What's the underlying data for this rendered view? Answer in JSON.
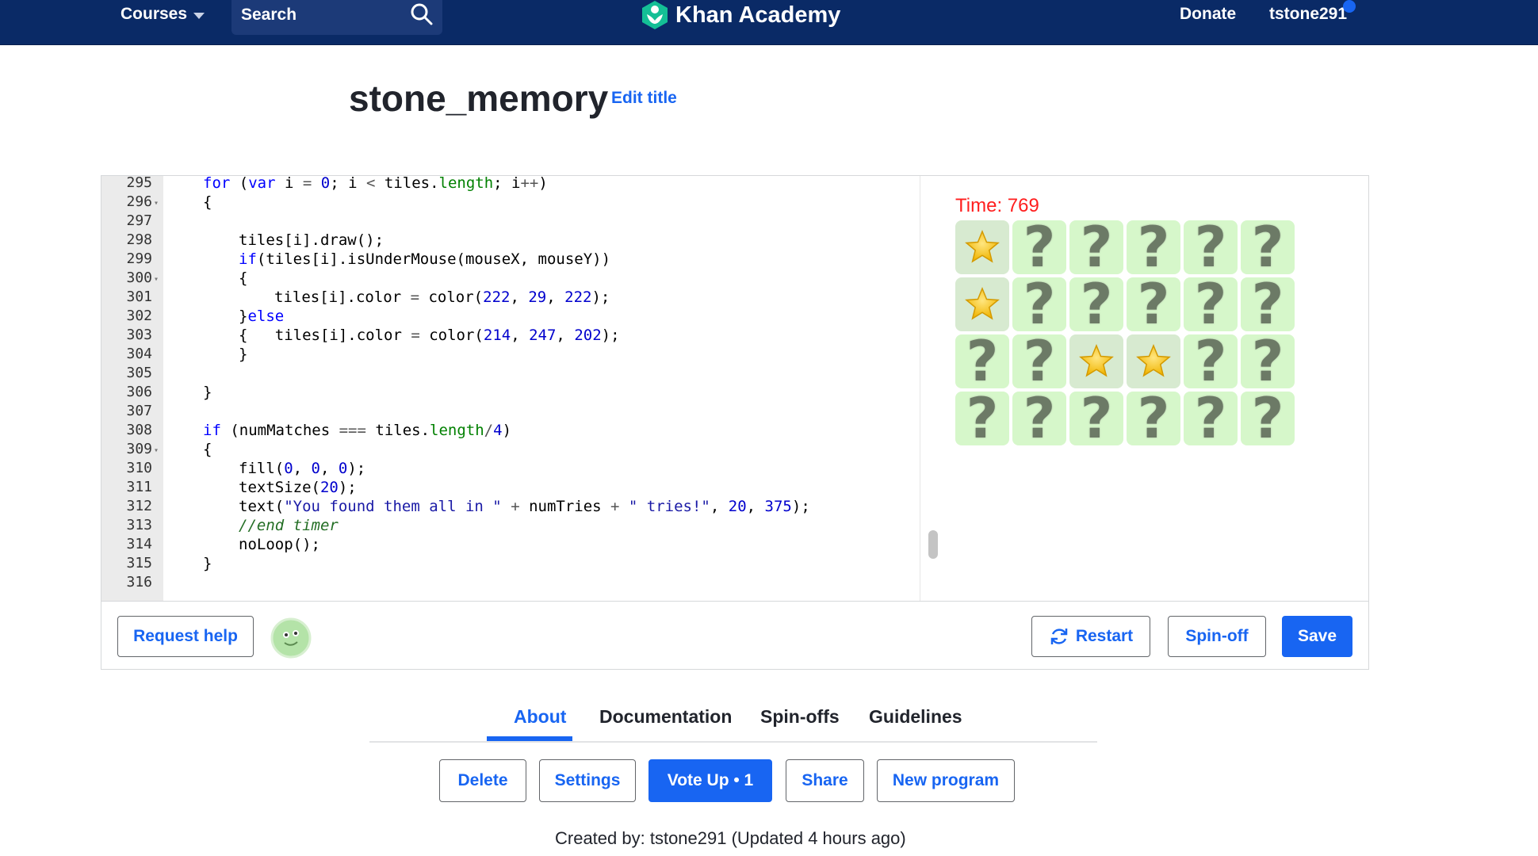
{
  "nav": {
    "courses_label": "Courses",
    "search_placeholder": "Search",
    "brand": "Khan Academy",
    "donate_label": "Donate",
    "username": "tstone291"
  },
  "program": {
    "title": "stone_memory",
    "edit_title_label": "Edit title"
  },
  "editor": {
    "lines": [
      {
        "n": "295",
        "fold": false,
        "tokens": [
          [
            "kw",
            "for "
          ],
          [
            "",
            "("
          ],
          [
            "kw",
            "var "
          ],
          [
            "",
            "i "
          ],
          [
            "op",
            "= "
          ],
          [
            "num",
            "0"
          ],
          [
            "",
            "; i "
          ],
          [
            "op",
            "< "
          ],
          [
            "",
            "tiles."
          ],
          [
            "prop",
            "length"
          ],
          [
            "",
            "; i"
          ],
          [
            "op",
            "++"
          ],
          [
            "",
            ")"
          ]
        ],
        "indent": 1
      },
      {
        "n": "296",
        "fold": true,
        "tokens": [
          [
            "",
            "{"
          ]
        ],
        "indent": 1
      },
      {
        "n": "297",
        "fold": false,
        "tokens": [],
        "indent": 1
      },
      {
        "n": "298",
        "fold": false,
        "tokens": [
          [
            "",
            "tiles[i].draw();"
          ]
        ],
        "indent": 2
      },
      {
        "n": "299",
        "fold": false,
        "tokens": [
          [
            "kw",
            "if"
          ],
          [
            "",
            "(tiles[i].isUnderMouse(mouseX, mouseY))"
          ]
        ],
        "indent": 2
      },
      {
        "n": "300",
        "fold": true,
        "tokens": [
          [
            "",
            "{"
          ]
        ],
        "indent": 2
      },
      {
        "n": "301",
        "fold": false,
        "tokens": [
          [
            "",
            "tiles[i].color "
          ],
          [
            "op",
            "= "
          ],
          [
            "",
            "color("
          ],
          [
            "num",
            "222"
          ],
          [
            "",
            ", "
          ],
          [
            "num",
            "29"
          ],
          [
            "",
            ", "
          ],
          [
            "num",
            "222"
          ],
          [
            "",
            ");"
          ]
        ],
        "indent": 3
      },
      {
        "n": "302",
        "fold": false,
        "tokens": [
          [
            "",
            "}"
          ],
          [
            "kw",
            "else"
          ]
        ],
        "indent": 2
      },
      {
        "n": "303",
        "fold": false,
        "tokens": [
          [
            "",
            "{   tiles[i].color "
          ],
          [
            "op",
            "= "
          ],
          [
            "",
            "color("
          ],
          [
            "num",
            "214"
          ],
          [
            "",
            ", "
          ],
          [
            "num",
            "247"
          ],
          [
            "",
            ", "
          ],
          [
            "num",
            "202"
          ],
          [
            "",
            ");"
          ]
        ],
        "indent": 2
      },
      {
        "n": "304",
        "fold": false,
        "tokens": [
          [
            "",
            "}"
          ]
        ],
        "indent": 2
      },
      {
        "n": "305",
        "fold": false,
        "tokens": [],
        "indent": 1
      },
      {
        "n": "306",
        "fold": false,
        "tokens": [
          [
            "",
            "}"
          ]
        ],
        "indent": 1
      },
      {
        "n": "307",
        "fold": false,
        "tokens": [],
        "indent": 1
      },
      {
        "n": "308",
        "fold": false,
        "tokens": [
          [
            "kw",
            "if "
          ],
          [
            "",
            "(numMatches "
          ],
          [
            "op",
            "=== "
          ],
          [
            "",
            "tiles."
          ],
          [
            "prop",
            "length"
          ],
          [
            "op",
            "/"
          ],
          [
            "num",
            "4"
          ],
          [
            "",
            ")"
          ]
        ],
        "indent": 1
      },
      {
        "n": "309",
        "fold": true,
        "tokens": [
          [
            "",
            "{"
          ]
        ],
        "indent": 1
      },
      {
        "n": "310",
        "fold": false,
        "tokens": [
          [
            "",
            "fill("
          ],
          [
            "num",
            "0"
          ],
          [
            "",
            ", "
          ],
          [
            "num",
            "0"
          ],
          [
            "",
            ", "
          ],
          [
            "num",
            "0"
          ],
          [
            "",
            ");"
          ]
        ],
        "indent": 2
      },
      {
        "n": "311",
        "fold": false,
        "tokens": [
          [
            "",
            "textSize("
          ],
          [
            "num",
            "20"
          ],
          [
            "",
            ");"
          ]
        ],
        "indent": 2
      },
      {
        "n": "312",
        "fold": false,
        "tokens": [
          [
            "",
            "text("
          ],
          [
            "str",
            "\"You found them all in \" "
          ],
          [
            "op",
            "+ "
          ],
          [
            "",
            "numTries "
          ],
          [
            "op",
            "+ "
          ],
          [
            "str",
            "\" tries!\""
          ],
          [
            "",
            ", "
          ],
          [
            "num",
            "20"
          ],
          [
            "",
            ", "
          ],
          [
            "num",
            "375"
          ],
          [
            "",
            ");"
          ]
        ],
        "indent": 2
      },
      {
        "n": "313",
        "fold": false,
        "tokens": [
          [
            "cm",
            "//end timer"
          ]
        ],
        "indent": 2
      },
      {
        "n": "314",
        "fold": false,
        "tokens": [
          [
            "",
            "noLoop();"
          ]
        ],
        "indent": 2
      },
      {
        "n": "315",
        "fold": false,
        "tokens": [
          [
            "",
            "}"
          ]
        ],
        "indent": 1
      },
      {
        "n": "316",
        "fold": false,
        "tokens": [],
        "indent": 1
      }
    ]
  },
  "canvas": {
    "timer_text": "Time: 769",
    "tiles": [
      [
        "star",
        "q",
        "q",
        "q",
        "q",
        "q"
      ],
      [
        "star",
        "q",
        "q",
        "q",
        "q",
        "q"
      ],
      [
        "q",
        "q",
        "star",
        "star",
        "q",
        "q"
      ],
      [
        "q",
        "q",
        "q",
        "q",
        "q",
        "q"
      ]
    ]
  },
  "actions": {
    "request_help_label": "Request help",
    "restart_label": "Restart",
    "spinoff_label": "Spin-off",
    "save_label": "Save"
  },
  "tabs": {
    "about": "About",
    "documentation": "Documentation",
    "spinoffs": "Spin-offs",
    "guidelines": "Guidelines"
  },
  "program_actions": {
    "delete_label": "Delete",
    "settings_label": "Settings",
    "vote_label": "Vote Up • 1",
    "share_label": "Share",
    "new_program_label": "New program"
  },
  "footer": {
    "created_text": "Created by: tstone291 (Updated 4 hours ago)"
  },
  "colors": {
    "nav_bg": "#0a2a66",
    "accent": "#1865f2",
    "keyword": "#0000ff",
    "number": "#0000cd",
    "string": "#1a1aa6",
    "comment": "#236e24",
    "property": "#008000",
    "timer": "#ff1e1e",
    "tile_bg": "#d6f7ca"
  }
}
